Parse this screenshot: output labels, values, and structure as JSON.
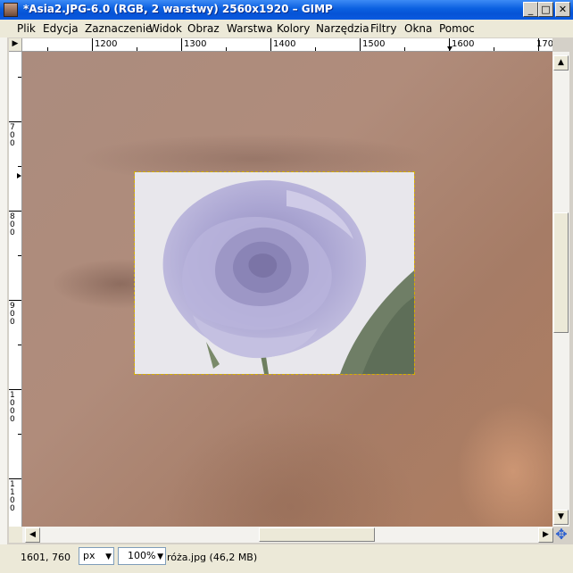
{
  "window": {
    "title": "*Asia2.JPG-6.0 (RGB, 2 warstwy) 2560x1920 – GIMP",
    "controls": {
      "minimize": "_",
      "maximize": "□",
      "close": "✕"
    }
  },
  "menu": [
    {
      "label": "Plik",
      "name": "menu-plik"
    },
    {
      "label": "Edycja",
      "name": "menu-edycja"
    },
    {
      "label": "Zaznaczenie",
      "name": "menu-zaznaczenie"
    },
    {
      "label": "Widok",
      "name": "menu-widok"
    },
    {
      "label": "Obraz",
      "name": "menu-obraz"
    },
    {
      "label": "Warstwa",
      "name": "menu-warstwa"
    },
    {
      "label": "Kolory",
      "name": "menu-kolory"
    },
    {
      "label": "Narzędzia",
      "name": "menu-narzedzia"
    },
    {
      "label": "Filtry",
      "name": "menu-filtry"
    },
    {
      "label": "Okna",
      "name": "menu-okna"
    },
    {
      "label": "Pomoc",
      "name": "menu-pomoc"
    }
  ],
  "rulers": {
    "horizontal": [
      "1200",
      "1300",
      "1400",
      "1500",
      "1600",
      "170"
    ],
    "vertical": [
      "700",
      "800",
      "900",
      "1000",
      "1100"
    ]
  },
  "statusbar": {
    "coords": "1601, 760",
    "unit": "px",
    "zoom": "100%",
    "file_info": "róża.jpg (46,2 MB)"
  },
  "icons": {
    "ruler_corner": "arrow-icon",
    "navigate": "navigate-icon"
  }
}
